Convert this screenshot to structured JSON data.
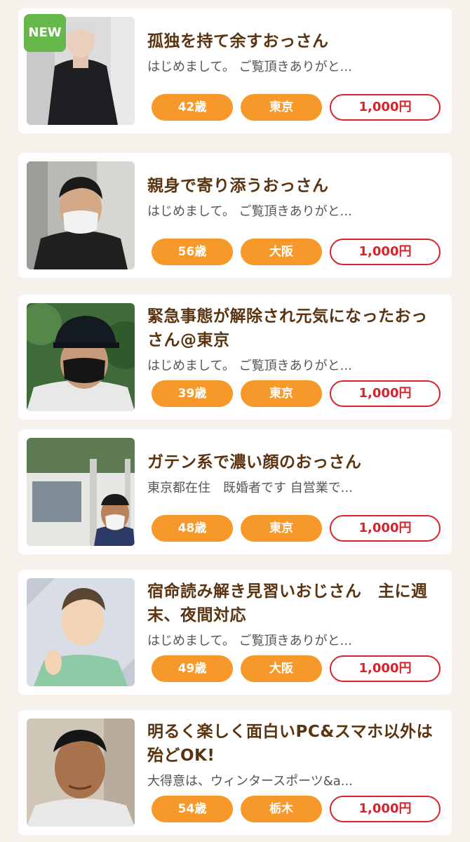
{
  "listings": [
    {
      "badge": "NEW",
      "title": "孤独を持て余すおっさん",
      "description": "はじめまして。 ご覧頂きありがと...",
      "age": "42歳",
      "location": "東京",
      "price": "1,000円"
    },
    {
      "title": "親身で寄り添うおっさん",
      "description": "はじめまして。 ご覧頂きありがと...",
      "age": "56歳",
      "location": "大阪",
      "price": "1,000円"
    },
    {
      "title": "緊急事態が解除され元気になったおっさん@東京",
      "description": "はじめまして。 ご覧頂きありがと...",
      "age": "39歳",
      "location": "東京",
      "price": "1,000円"
    },
    {
      "title": "ガテン系で濃い顔のおっさん",
      "description": "東京都在住　既婚者です 自営業で...",
      "age": "48歳",
      "location": "東京",
      "price": "1,000円"
    },
    {
      "title": "宿命読み解き見習いおじさん　主に週末、夜間対応",
      "description": "はじめまして。 ご覧頂きありがと...",
      "age": "49歳",
      "location": "大阪",
      "price": "1,000円"
    },
    {
      "title": "明るく楽しく面白いPC&スマホ以外は殆どOK!",
      "description": "大得意は、ウィンタースポーツ&a...",
      "age": "54歳",
      "location": "栃木",
      "price": "1,000円"
    }
  ],
  "colors": {
    "background": "#f6f1ea",
    "title": "#5a3410",
    "tag": "#f7992a",
    "price": "#d8232a",
    "new_badge": "#66b84a"
  }
}
